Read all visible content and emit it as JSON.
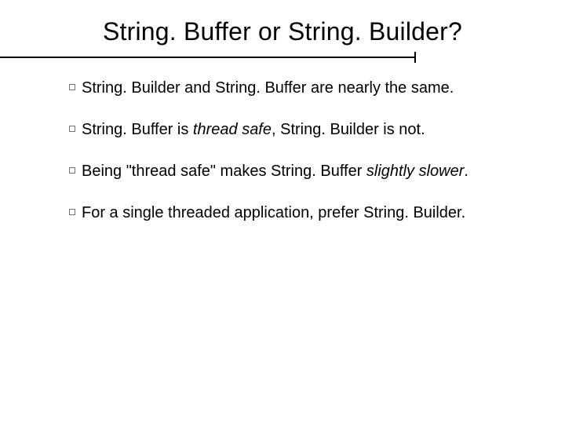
{
  "title": "String. Buffer or String. Builder?",
  "bullets": [
    {
      "segments": [
        {
          "text": "String. Builder and String. Buffer are nearly the same."
        }
      ]
    },
    {
      "segments": [
        {
          "text": "String. Buffer is "
        },
        {
          "text": "thread safe",
          "italic": true
        },
        {
          "text": ", String. Builder is not."
        }
      ]
    },
    {
      "segments": [
        {
          "text": "Being \"thread safe\" makes String. Buffer "
        },
        {
          "text": "slightly slower",
          "italic": true
        },
        {
          "text": "."
        }
      ]
    },
    {
      "segments": [
        {
          "text": "For a single threaded application, prefer String. Builder."
        }
      ]
    }
  ]
}
